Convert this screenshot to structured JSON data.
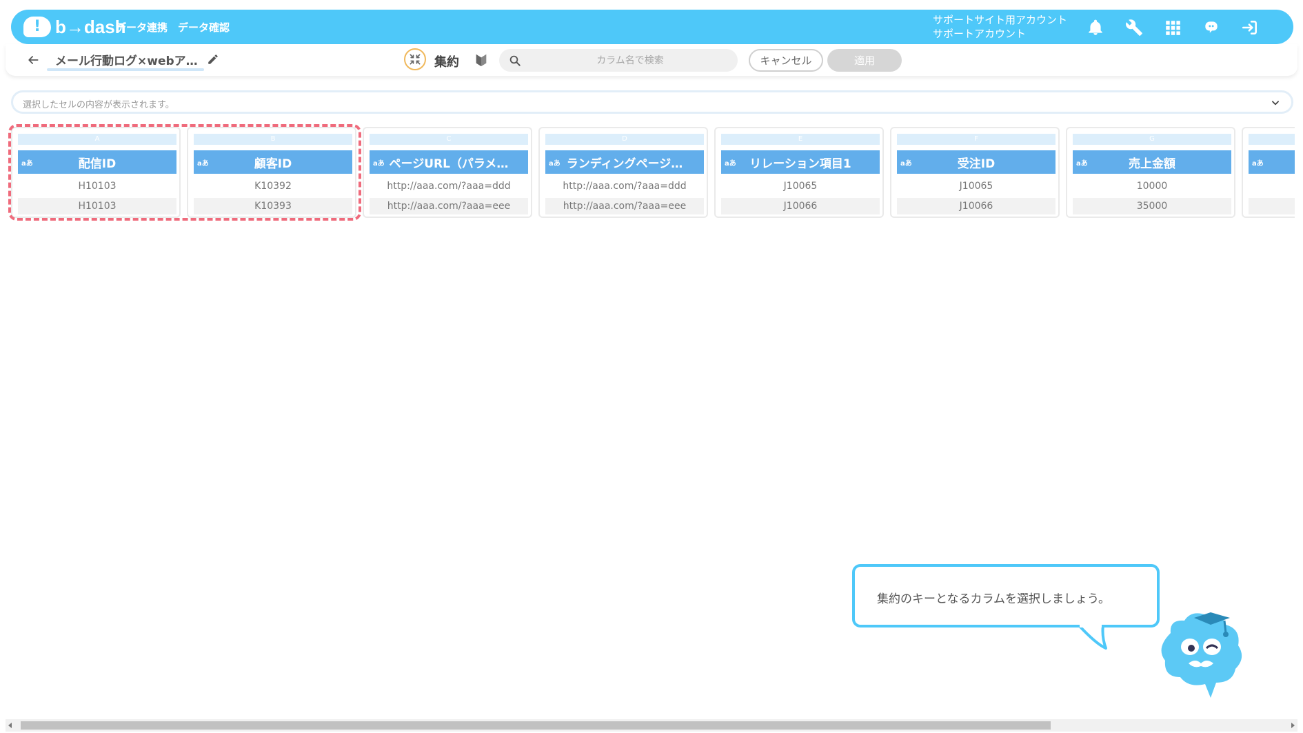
{
  "header": {
    "logo_text": "b→dash",
    "nav": [
      "データ連携",
      "データ確認"
    ],
    "account_line1": "サポートサイト用アカウント",
    "account_line2": "サポートアカウント"
  },
  "toolbar": {
    "title": "メール行動ログ×webア…",
    "aggregate_label": "集約",
    "cancel_label": "キャンセル",
    "apply_label": "適用"
  },
  "search": {
    "placeholder": "カラム名で検索"
  },
  "cellbar": {
    "text": "選択したセルの内容が表示されます。"
  },
  "columns": [
    {
      "letter": "A",
      "type": "aあ",
      "name": "配信ID",
      "rows": [
        "H10103",
        "H10103"
      ]
    },
    {
      "letter": "B",
      "type": "aあ",
      "name": "顧客ID",
      "rows": [
        "K10392",
        "K10393"
      ]
    },
    {
      "letter": "C",
      "type": "aあ",
      "name": "ページURL（パラメ…",
      "rows": [
        "http://aaa.com/?aaa=ddd",
        "http://aaa.com/?aaa=eee"
      ]
    },
    {
      "letter": "D",
      "type": "aあ",
      "name": "ランディングページ…",
      "rows": [
        "http://aaa.com/?aaa=ddd",
        "http://aaa.com/?aaa=eee"
      ]
    },
    {
      "letter": "E",
      "type": "aあ",
      "name": "リレーション項目1",
      "rows": [
        "J10065",
        "J10066"
      ]
    },
    {
      "letter": "F",
      "type": "aあ",
      "name": "受注ID",
      "rows": [
        "J10065",
        "J10066"
      ]
    },
    {
      "letter": "G",
      "type": "aあ",
      "name": "売上金額",
      "rows": [
        "10000",
        "35000"
      ]
    },
    {
      "letter": "",
      "type": "aあ",
      "name": "",
      "rows": [
        "",
        ""
      ]
    }
  ],
  "guide": {
    "bubble_text": "集約のキーとなるカラムを選択しましょう。"
  },
  "colors": {
    "brand": "#4ec8f9",
    "column_header": "#62aeeb",
    "highlight": "#ef6b7c",
    "accent_ring": "#f0b85b"
  }
}
